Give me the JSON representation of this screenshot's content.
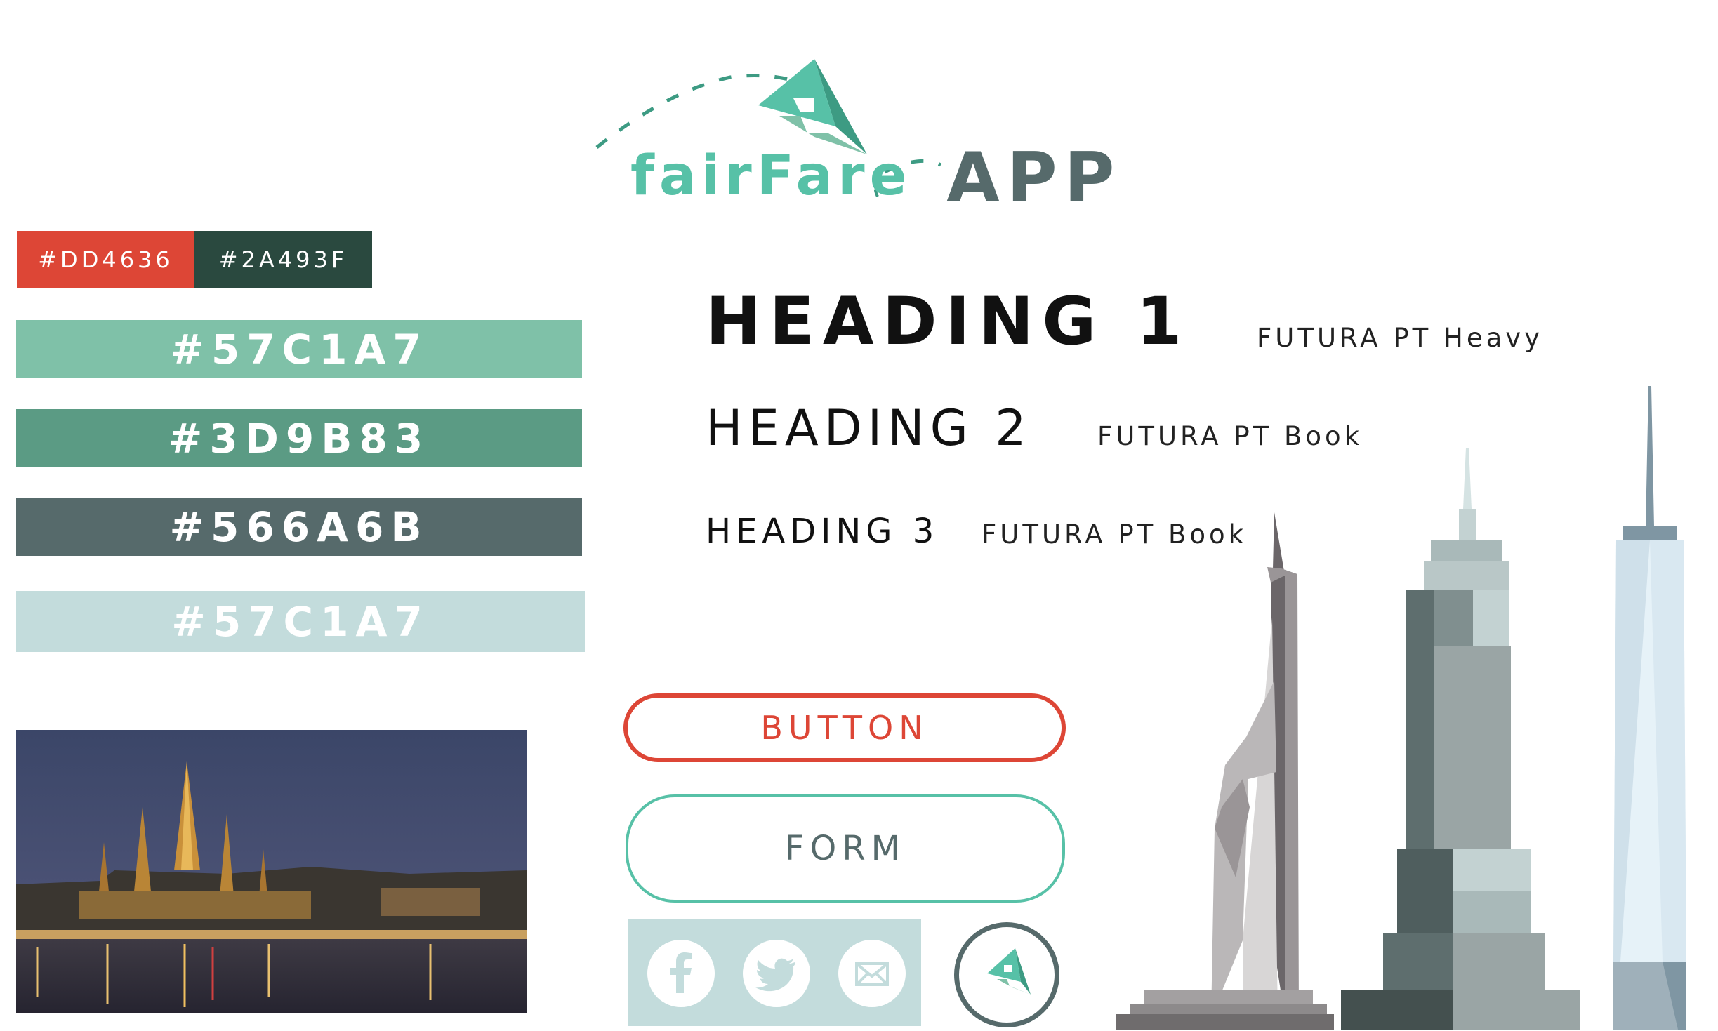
{
  "logo": {
    "name_part1": "fairFare",
    "name_part2": "APP"
  },
  "palette_small": [
    {
      "label": "#DD4636",
      "color": "#DD4636"
    },
    {
      "label": "#2A493F",
      "color": "#2A493F"
    }
  ],
  "palette_large": [
    {
      "label": "#57C1A7",
      "color": "#7FC1A8"
    },
    {
      "label": "#3D9B83",
      "color": "#5B9B84"
    },
    {
      "label": "#566A6B",
      "color": "#566A6B"
    },
    {
      "label": "#57C1A7",
      "color": "#C3DCDC"
    }
  ],
  "typography": {
    "h1": {
      "text": "HEADING 1",
      "font": "FUTURA PT Heavy"
    },
    "h2": {
      "text": "HEADING 2",
      "font": "FUTURA PT Book"
    },
    "h3": {
      "text": "HEADING 3",
      "font": "FUTURA PT Book"
    }
  },
  "buttons": {
    "primary": "BUTTON",
    "form": "FORM"
  },
  "social_icons": [
    "facebook-icon",
    "twitter-icon",
    "mail-icon"
  ],
  "colors": {
    "accent": "#57C1A7",
    "dark": "#566A6B",
    "red": "#DD4636",
    "light": "#C3DCDC"
  }
}
